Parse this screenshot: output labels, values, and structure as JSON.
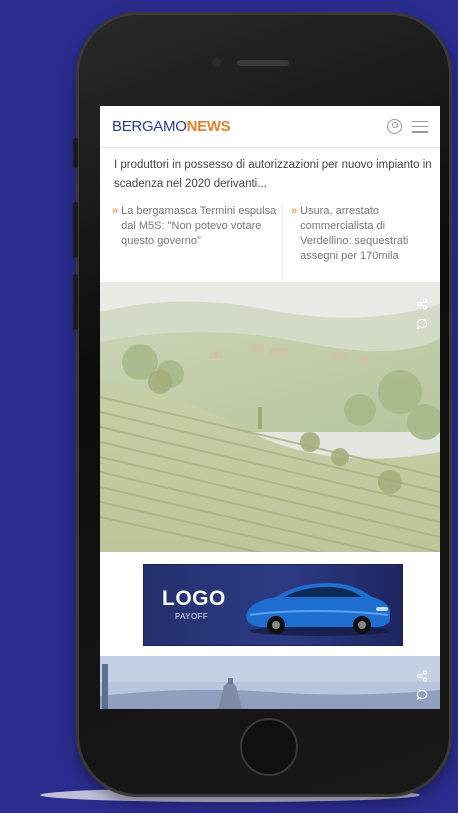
{
  "site": {
    "logo_part1": "BERGAMO",
    "logo_part2": "NEWS",
    "brand_color": "#2b3a8c",
    "accent_color": "#e57f2a"
  },
  "header_icons": [
    "user-icon",
    "menu-icon"
  ],
  "intro_text": "I produttori in possesso di autorizzazioni per nuovo impianto in scadenza nel 2020 derivanti...",
  "teasers": [
    {
      "marker": "»",
      "text": "La bergamasca Termini espulsa dal M5S: \"Non potevo votare questo governo\""
    },
    {
      "marker": "»",
      "text": "Usura, arrestato commercialista di Verdellino: sequestrati assegni per 170mila"
    }
  ],
  "hero_icons": [
    "share-icon",
    "comment-icon"
  ],
  "ad": {
    "logo": "LOGO",
    "payoff": "PAYOFF"
  },
  "bottom_icons": [
    "share-icon",
    "comment-icon"
  ],
  "background_color": "#2b2d8e"
}
